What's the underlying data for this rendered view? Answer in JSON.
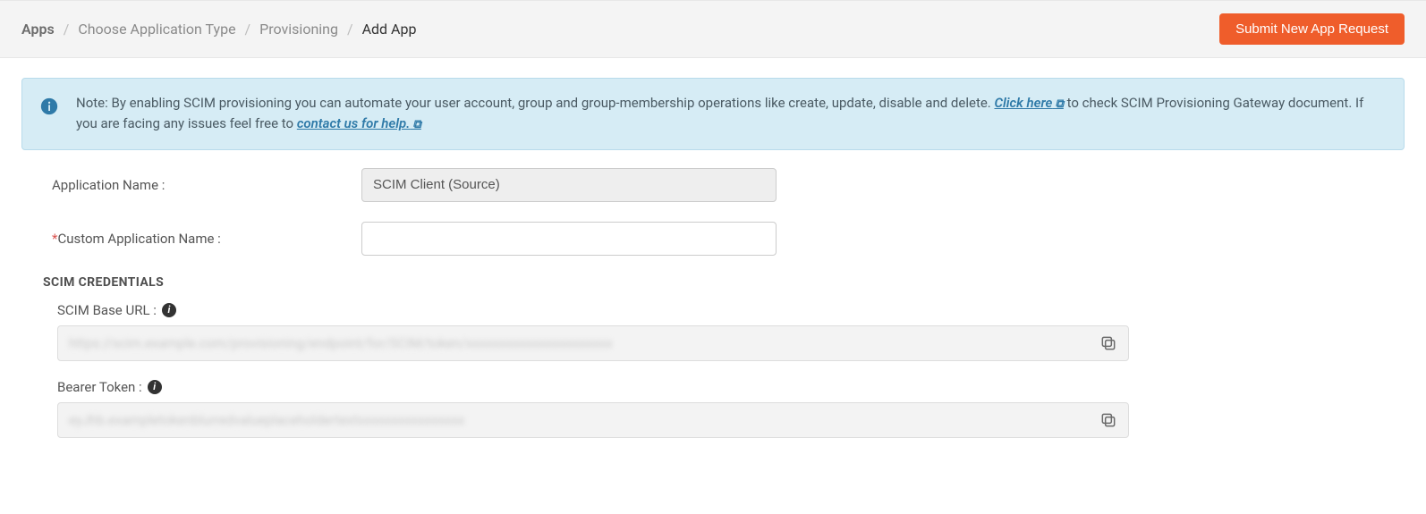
{
  "breadcrumb": {
    "root": "Apps",
    "choose": "Choose Application Type",
    "provisioning": "Provisioning",
    "current": "Add App"
  },
  "actions": {
    "submit_request": "Submit New App Request"
  },
  "alert": {
    "note_prefix": "Note: By enabling SCIM provisioning you can automate your user account, group and group-membership operations like create, update, disable and delete. ",
    "click_here": "Click here",
    "note_mid": " to check SCIM Provisioning Gateway document. If you are facing any issues feel free to ",
    "contact": "contact us for help."
  },
  "form": {
    "app_name_label": "Application Name :",
    "app_name_value": "SCIM Client (Source)",
    "custom_name_label": "Custom Application Name :",
    "custom_name_value": ""
  },
  "section": {
    "credentials_title": "SCIM CREDENTIALS",
    "base_url_label": "SCIM Base URL :",
    "base_url_value": "https://scim.example.com/provisioning/endpoint/for/SCIM/token/xxxxxxxxxxxxxxxxxxxxxx",
    "bearer_label": "Bearer Token :",
    "bearer_value": "eyJhb.exampletokenblurredvalueplaceholdertextxxxxxxxxxxxxxxxx"
  }
}
